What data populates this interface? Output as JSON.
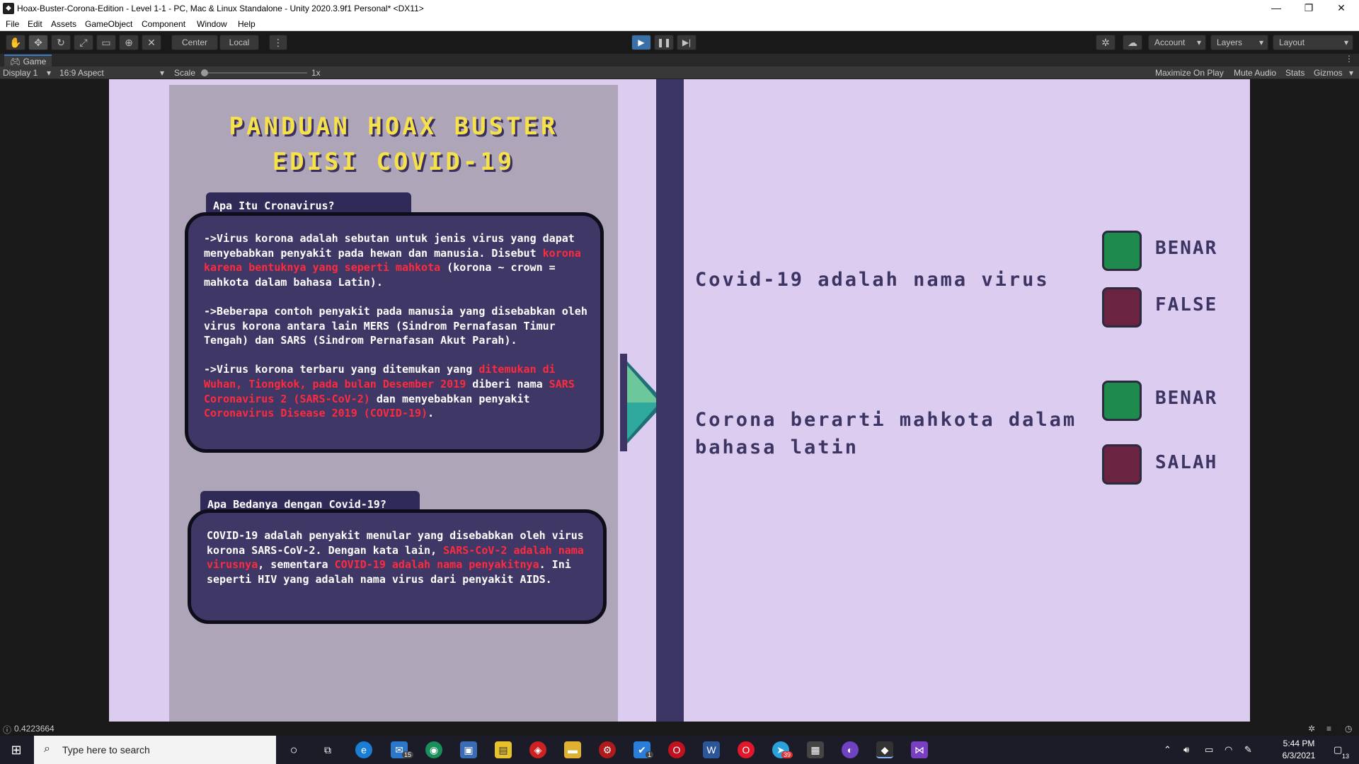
{
  "window": {
    "title": "Hoax-Buster-Corona-Edition - Level 1-1 - PC, Mac & Linux Standalone - Unity 2020.3.9f1 Personal* <DX11>",
    "minimize": "—",
    "restore": "❐",
    "close": "✕"
  },
  "menu": [
    "File",
    "Edit",
    "Assets",
    "GameObject",
    "Component",
    "Window",
    "Help"
  ],
  "toolbar": {
    "center_label": "Center",
    "local_label": "Local",
    "account_label": "Account",
    "layers_label": "Layers",
    "layout_label": "Layout"
  },
  "game_tab": {
    "tab_label": "Game",
    "display": "Display 1",
    "aspect": "16:9 Aspect",
    "scale_label": "Scale",
    "scale_value": "1x",
    "maximize_on_play": "Maximize On Play",
    "mute_audio": "Mute Audio",
    "stats": "Stats",
    "gizmos": "Gizmos"
  },
  "game": {
    "guide_title_line1": "PANDUAN HOAX BUSTER",
    "guide_title_line2": "EDISI COVID-19",
    "section1": {
      "heading": "Apa Itu Cronavirus?",
      "p1_a": "->Virus korona adalah sebutan untuk jenis virus yang dapat menyebabkan penyakit pada hewan dan manusia. Disebut ",
      "p1_red": "korona karena bentuknya yang seperti mahkota",
      "p1_b": " (korona ~ crown = mahkota dalam bahasa Latin).",
      "p2": "->Beberapa contoh penyakit pada manusia yang disebabkan oleh virus korona antara lain MERS (Sindrom Pernafasan Timur Tengah) dan SARS (Sindrom Pernafasan Akut Parah).",
      "p3_a": "->Virus korona terbaru yang ditemukan yang ",
      "p3_red1": "ditemukan di Wuhan, Tiongkok, pada bulan Desember 2019",
      "p3_b": " diberi nama ",
      "p3_red2": "SARS Coronavirus 2 (SARS-CoV-2)",
      "p3_c": " dan menyebabkan penyakit ",
      "p3_red3": "Coronavirus Disease 2019 (COVID-19)",
      "p3_d": "."
    },
    "section2": {
      "heading": "Apa Bedanya dengan Covid-19?",
      "p_a": "  COVID-19 adalah penyakit menular yang disebabkan oleh virus korona SARS-CoV-2. Dengan kata lain, ",
      "p_red1": "SARS-CoV-2 adalah nama virusnya",
      "p_b": ", sementara ",
      "p_red2": "COVID-19 adalah nama penyakitnya",
      "p_c": ". Ini seperti HIV yang adalah nama virus dari penyakit AIDS."
    },
    "question1": "Covid-19 adalah nama virus",
    "q1_answer_true": "BENAR",
    "q1_answer_false": "FALSE",
    "question2_line1": "Corona berarti mahkota dalam",
    "question2_line2": "bahasa latin",
    "q2_answer_true": "BENAR",
    "q2_answer_false": "SALAH",
    "colors": {
      "true_button": "#1e8a4e",
      "false_button": "#6a2442",
      "title": "#f5e14a",
      "highlight": "#ff2a3e"
    }
  },
  "status": {
    "value": "0.4223664"
  },
  "taskbar": {
    "search_placeholder": "Type here to search",
    "mail_badge": "15",
    "todo_badge": "1",
    "telegram_badge": "39",
    "time": "5:44 PM",
    "date": "6/3/2021",
    "notification_badge": "13"
  }
}
